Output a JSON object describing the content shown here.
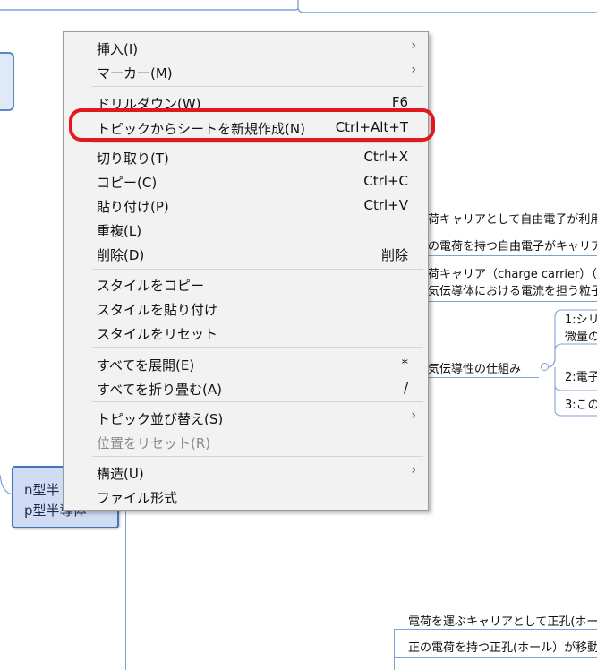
{
  "mindmap": {
    "left_node": {
      "line1": "n型半",
      "line2": "p型半導体"
    },
    "topics": [
      "荷キャリアとして自由電子が利用",
      "の電荷を持つ自由電子がキャリア",
      "荷キャリア（charge carrier）（電荷",
      "気伝導体における電流を担う粒子",
      "気伝導性の仕組み",
      "1:シリ",
      "微量の",
      "2:電子",
      "3:この",
      "電荷を運ぶキャリアとして正孔(ホール",
      "正の電荷を持つ正孔(ホール）が移動"
    ]
  },
  "context_menu": {
    "items": [
      {
        "label": "挿入(I)",
        "shortcut": "",
        "submenu": true
      },
      {
        "label": "マーカー(M)",
        "shortcut": "",
        "submenu": true
      },
      {
        "label": "ドリルダウン(W)",
        "shortcut": "F6",
        "submenu": false
      },
      {
        "label": "トピックからシートを新規作成(N)",
        "shortcut": "Ctrl+Alt+T",
        "submenu": false
      },
      {
        "label": "切り取り(T)",
        "shortcut": "Ctrl+X",
        "submenu": false
      },
      {
        "label": "コピー(C)",
        "shortcut": "Ctrl+C",
        "submenu": false
      },
      {
        "label": "貼り付け(P)",
        "shortcut": "Ctrl+V",
        "submenu": false
      },
      {
        "label": "重複(L)",
        "shortcut": "",
        "submenu": false
      },
      {
        "label": "削除(D)",
        "shortcut": "削除",
        "submenu": false
      },
      {
        "label": "スタイルをコピー",
        "shortcut": "",
        "submenu": false
      },
      {
        "label": "スタイルを貼り付け",
        "shortcut": "",
        "submenu": false
      },
      {
        "label": "スタイルをリセット",
        "shortcut": "",
        "submenu": false
      },
      {
        "label": "すべてを展開(E)",
        "shortcut": "*",
        "submenu": false
      },
      {
        "label": "すべてを折り畳む(A)",
        "shortcut": "/",
        "submenu": false
      },
      {
        "label": "トピック並び替え(S)",
        "shortcut": "",
        "submenu": true
      },
      {
        "label": "位置をリセット(R)",
        "shortcut": "",
        "submenu": false,
        "disabled": true
      },
      {
        "label": "構造(U)",
        "shortcut": "",
        "submenu": true
      },
      {
        "label": "ファイル形式",
        "shortcut": "",
        "submenu": false
      }
    ],
    "highlighted_item": "トピックからシートを新規作成(N)",
    "highlight_color": "#e0191e"
  }
}
